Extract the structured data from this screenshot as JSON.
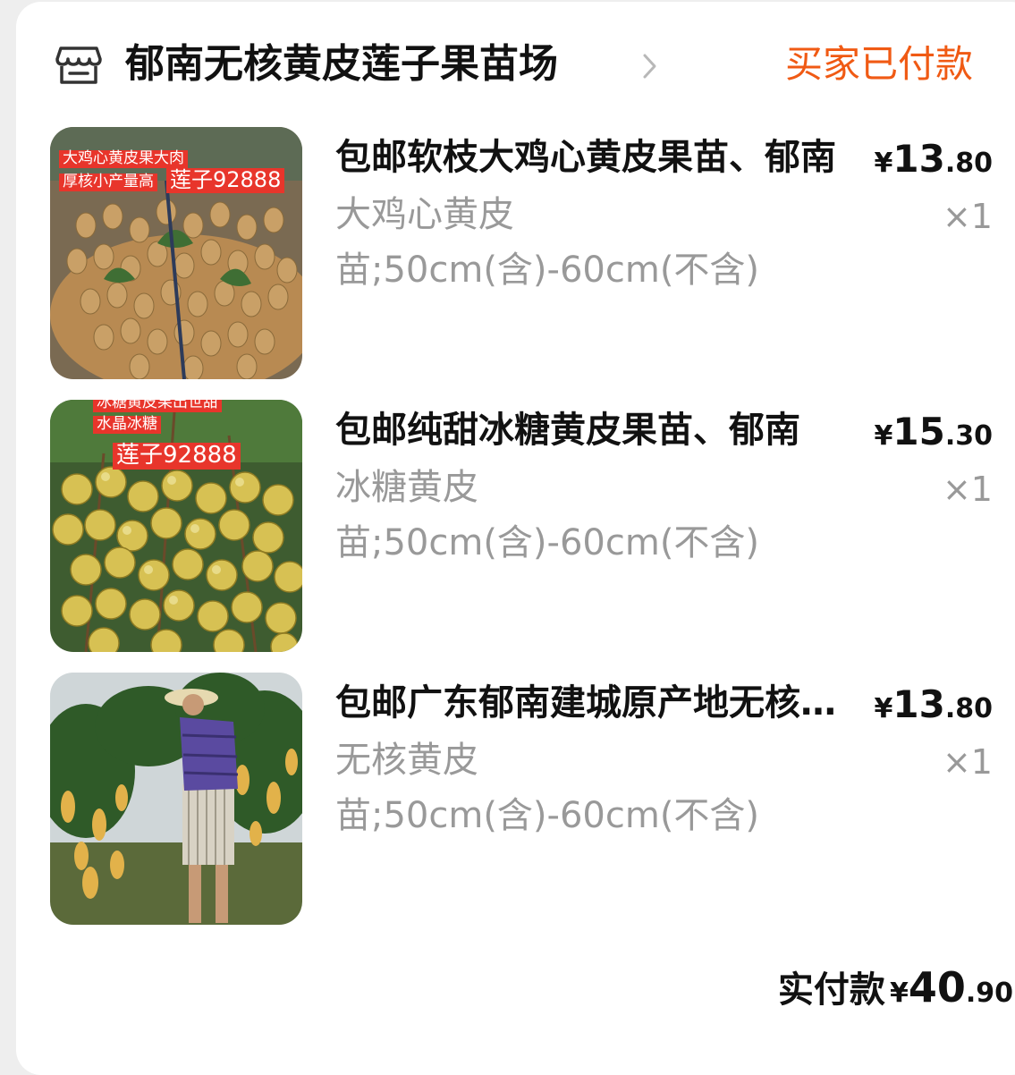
{
  "shop": {
    "name": "郁南无核黄皮莲子果苗场",
    "status": "买家已付款",
    "icon": "store-icon",
    "chevron_icon": "chevron-right-icon"
  },
  "items": [
    {
      "title": "包邮软枝大鸡心黄皮果苗、郁南",
      "price_currency": "¥",
      "price_int": "13",
      "price_dec": ".80",
      "variant": "大鸡心黄皮",
      "quantity": "×1",
      "spec": "苗;50cm(含)-60cm(不含)",
      "image_text": [
        "大鸡心黄皮果大肉",
        "厚核小产量高",
        "莲子92888"
      ]
    },
    {
      "title": "包邮纯甜冰糖黄皮果苗、郁南",
      "price_currency": "¥",
      "price_int": "15",
      "price_dec": ".30",
      "variant": "冰糖黄皮",
      "quantity": "×1",
      "spec": "苗;50cm(含)-60cm(不含)",
      "image_text": [
        "冰糖黄皮果出世甜",
        "水晶冰糖",
        "莲子92888"
      ]
    },
    {
      "title": "包邮广东郁南建城原产地无核黄皮",
      "price_currency": "¥",
      "price_int": "13",
      "price_dec": ".80",
      "variant": "无核黄皮",
      "quantity": "×1",
      "spec": "苗;50cm(含)-60cm(不含)"
    }
  ],
  "total": {
    "label": "实付款",
    "currency": "¥",
    "int": "40",
    "dec": ".90"
  },
  "colors": {
    "accent": "#f05a14",
    "tag_red": "#e8352b",
    "text_primary": "#111111",
    "text_secondary": "#999999"
  }
}
